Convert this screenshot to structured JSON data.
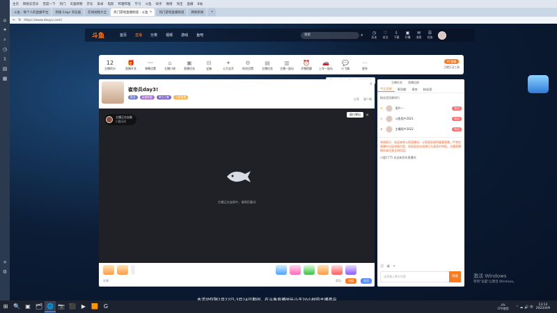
{
  "browser": {
    "favorites": [
      "主页",
      "网易云音乐",
      "百度一下",
      "热门",
      "天猫购物",
      "京东",
      "安卓",
      "电影",
      "哔哩哔哩",
      "学习",
      "斗鱼",
      "知乎",
      "微博",
      "淘宝",
      "直播",
      "B站"
    ],
    "tabs": [
      "斗鱼 - 每个人的直播平台",
      "新版 Edge 浏览器",
      "在线视频大全",
      "热门游戏直播频道",
      "网易新闻"
    ],
    "active_tab": "热门游戏直播频道 - 斗鱼",
    "address": "https://www.douyu.com/"
  },
  "site": {
    "logo": "斗鱼",
    "nav": [
      "首页",
      "直播",
      "分类",
      "视频",
      "游戏",
      "鱼吧"
    ],
    "nav_active_index": 1,
    "search_placeholder": "搜索",
    "header_actions": [
      "历史",
      "关注",
      "下载",
      "开播",
      "消息",
      "任务"
    ]
  },
  "toolbar": {
    "level_num": "12",
    "level_label": "主播积分",
    "items": [
      {
        "icon": "🎁",
        "label": "直播开关"
      },
      {
        "icon": "〰",
        "label": "弹幕设置"
      },
      {
        "icon": "⌂",
        "label": "主播口袋"
      },
      {
        "icon": "▣",
        "label": "直播任务"
      },
      {
        "icon": "⊟",
        "label": "宝箱"
      },
      {
        "icon": "✦",
        "label": "火力全开"
      },
      {
        "icon": "⚙",
        "label": "房间设置"
      },
      {
        "icon": "▤",
        "label": "主播任务"
      },
      {
        "icon": "▥",
        "label": "主播一起玩"
      },
      {
        "icon": "⏰",
        "label": "开播提醒"
      },
      {
        "icon": "🚗",
        "label": "上车一起玩"
      },
      {
        "icon": "💬",
        "label": "小飞猫"
      },
      {
        "icon": "⋯",
        "label": "更多"
      }
    ],
    "pc_button": "PC直播",
    "pc_sub": "主播互动工具",
    "tooltip": "开启上车功能，请先加一起玩团队哦"
  },
  "room": {
    "title": "崔帝兵day3!",
    "tags": [
      "职业",
      "英雄联盟",
      "峡谷之巅",
      "斗鱼直播"
    ],
    "badges": [
      "分享",
      "客户端"
    ],
    "anchor_name": "主播正在加载",
    "anchor_level": "小鹿无间",
    "player_status": "主播正在连接中，请稍后重试",
    "pop_button": "窗口弹出",
    "follow_count": "8",
    "bottom_bar": [
      "礼物",
      "背包",
      "充值",
      "关注"
    ]
  },
  "rightpanel": {
    "tabs": [
      "今日贡献",
      "周贡献",
      "贵宾",
      "粉丝团"
    ],
    "top_actions": [
      "主播任务",
      "直播回顾"
    ],
    "rank_title": "粉丝团贡献排行",
    "ranks": [
      {
        "name": "用户一",
        "badge": "粉丝"
      },
      {
        "name": "斗鱼用户2021",
        "badge": "粉丝"
      },
      {
        "name": "主播用户2022",
        "badge": "粉丝"
      }
    ],
    "chat_notice": "系统提示：欢迎来到斗鱼直播间，斗鱼倡导绿色健康直播，严禁在直播中出现违规内容，如发现违法违规行为请及时举报。主播直播期间请注意文明用语。",
    "chat_user": "小鹿1775 欢迎来到本直播间",
    "input_placeholder": "这里输入聊天内容",
    "send_button": "发送"
  },
  "caption": "本活动仅限2月22日-3月24日期间，在斗鱼直播时长小于20小时的主播参与",
  "windows_watermark": {
    "title": "激活 Windows",
    "sub": "转到\"设置\"以激活 Windows。"
  },
  "taskbar": {
    "time": "13:13",
    "date": "2022/4/9",
    "cpu": "4%",
    "cpu_label": "CPU使用",
    "apps": [
      "⊞",
      "🔍",
      "▣",
      "🗂",
      "🌐",
      "📷",
      "⬛",
      "▶",
      "🟧",
      "G"
    ]
  }
}
